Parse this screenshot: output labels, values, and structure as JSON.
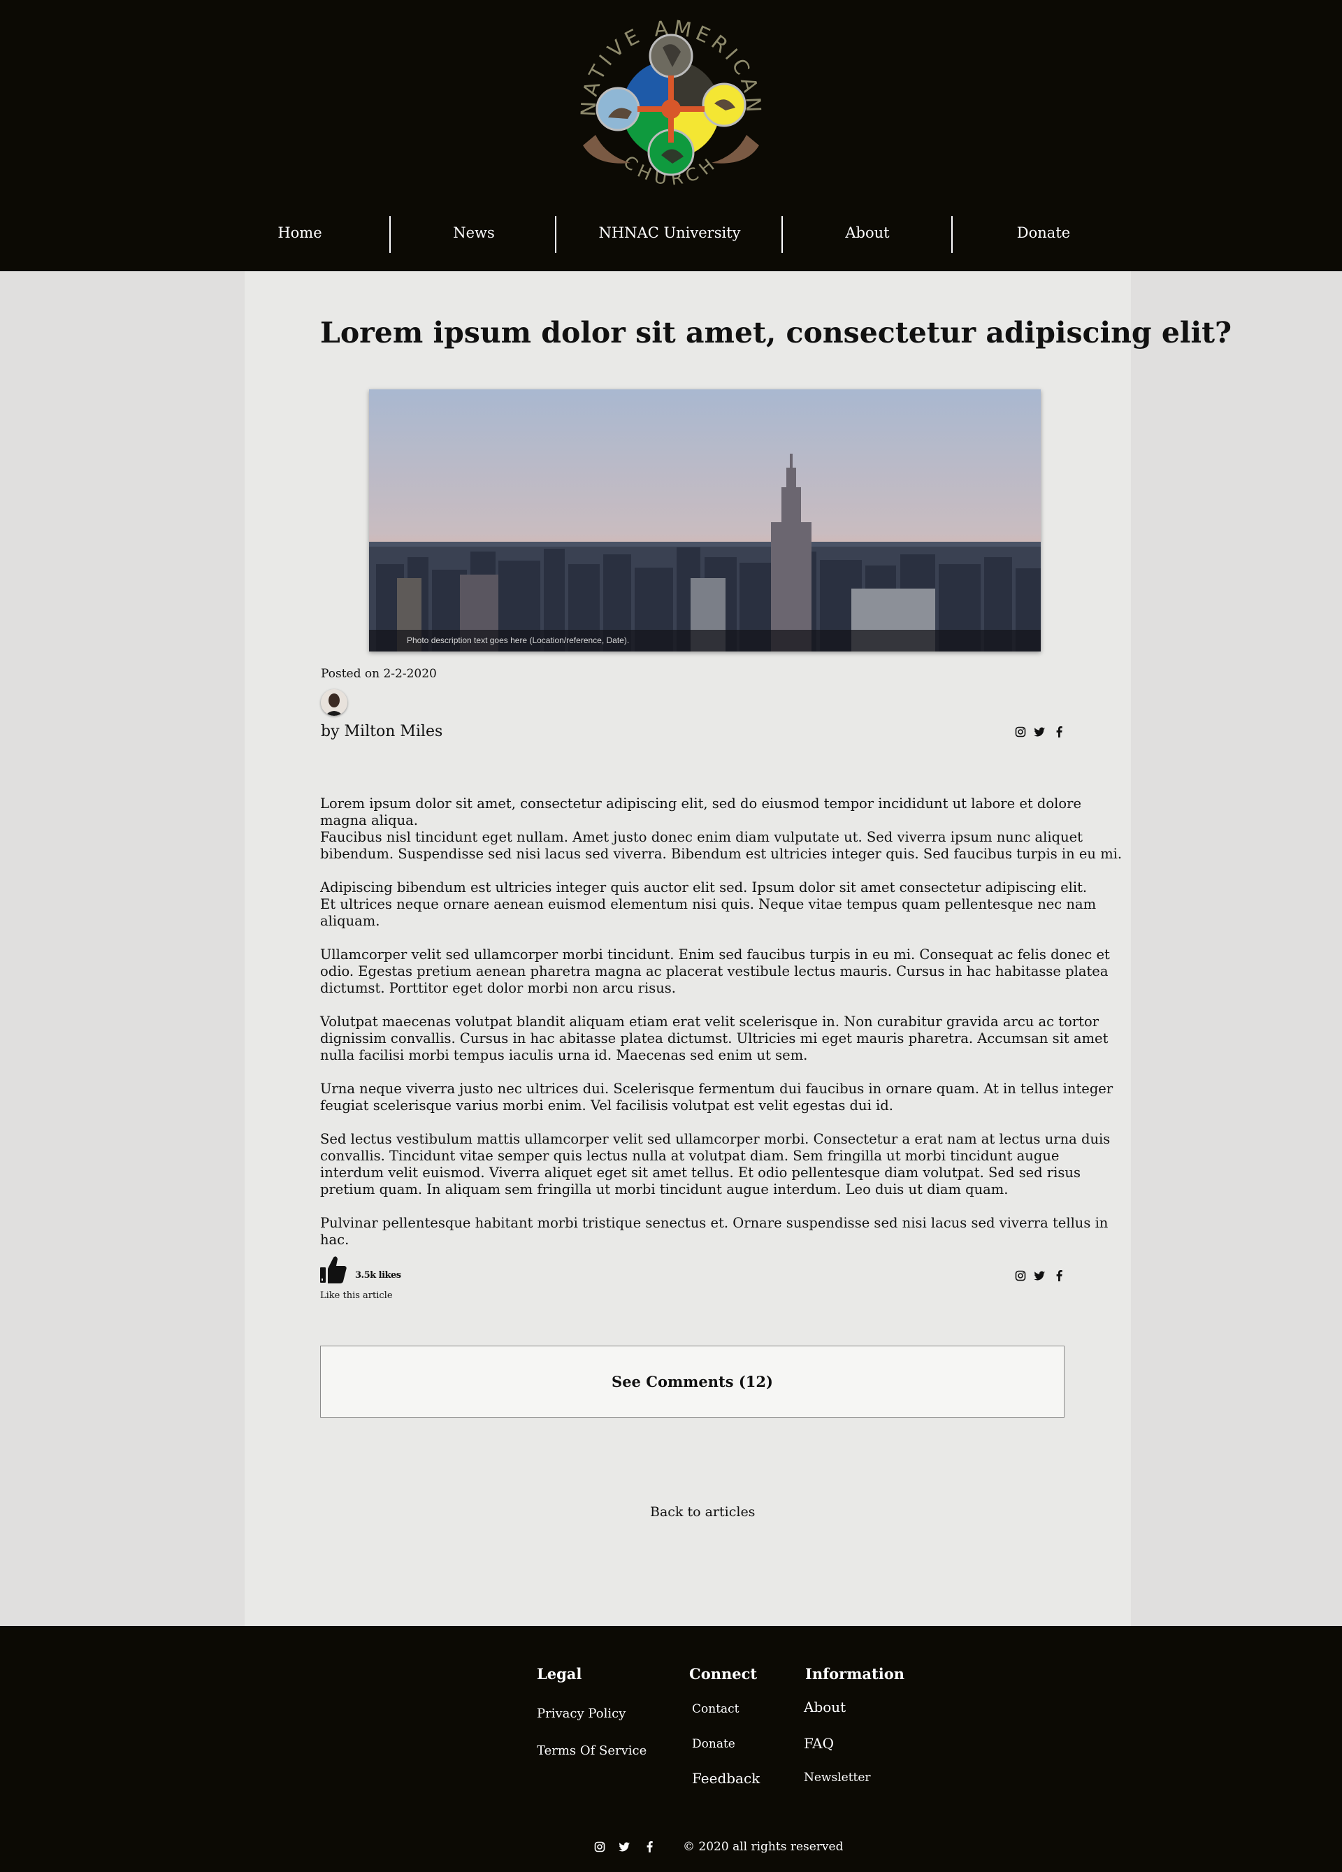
{
  "header": {
    "logo_text_top": "NATIVE AMERICAN",
    "logo_text_bottom": "CHURCH",
    "nav": [
      {
        "label": "Home"
      },
      {
        "label": "News"
      },
      {
        "label": "NHNAC University"
      },
      {
        "label": "About"
      },
      {
        "label": "Donate"
      }
    ]
  },
  "post": {
    "title": "Lorem ipsum dolor sit amet, consectetur adipiscing elit?",
    "photo_caption": "Photo description text goes here (Location/reference, Date).",
    "posted_on": "Posted on 2-2-2020",
    "author": "by Milton Miles",
    "paragraphs": [
      "Lorem ipsum dolor sit amet, consectetur adipiscing elit, sed do eiusmod tempor incididunt ut labore et dolore magna aliqua.\nFaucibus nisl tincidunt eget nullam. Amet justo donec enim diam vulputate ut. Sed viverra ipsum nunc aliquet bibendum. Suspendisse sed nisi lacus sed viverra. Bibendum est ultricies integer quis. Sed faucibus turpis in eu mi.",
      "Adipiscing bibendum est ultricies integer quis auctor elit sed. Ipsum dolor sit amet consectetur adipiscing elit.\nEt ultrices neque ornare aenean euismod elementum nisi quis. Neque vitae tempus quam pellentesque nec nam aliquam.",
      "Ullamcorper velit sed ullamcorper morbi tincidunt. Enim sed faucibus turpis in eu mi. Consequat ac felis donec et odio. Egestas pretium aenean pharetra magna ac placerat vestibule lectus mauris. Cursus in hac habitasse platea dictumst. Porttitor eget dolor morbi non arcu risus.",
      "Volutpat maecenas volutpat blandit aliquam etiam erat velit scelerisque in. Non curabitur gravida arcu ac tortor dignissim convallis. Cursus in hac abitasse platea dictumst. Ultricies mi eget mauris pharetra. Accumsan sit amet nulla facilisi morbi tempus iaculis urna id. Maecenas sed enim ut sem.",
      "Urna neque viverra justo nec ultrices dui. Scelerisque fermentum dui faucibus in ornare quam. At in tellus integer feugiat scelerisque varius morbi enim. Vel facilisis volutpat est velit egestas dui id.",
      "Sed lectus vestibulum mattis ullamcorper velit sed ullamcorper morbi. Consectetur a erat nam at lectus urna duis convallis. Tincidunt vitae semper quis lectus nulla at volutpat diam. Sem fringilla ut morbi tincidunt augue interdum velit euismod. Viverra aliquet eget sit amet tellus. Et odio pellentesque diam volutpat. Sed sed risus pretium quam. In aliquam sem fringilla ut morbi tincidunt augue interdum. Leo duis ut diam quam.",
      "Pulvinar pellentesque habitant morbi tristique senectus et. Ornare suspendisse sed nisi lacus sed viverra tellus in hac."
    ],
    "likes_count": "3.5k likes",
    "like_label": "Like this article",
    "comments_button": "See Comments (12)",
    "back_link": "Back to articles"
  },
  "social_icons": [
    "instagram-icon",
    "twitter-icon",
    "facebook-icon"
  ],
  "footer": {
    "legal": {
      "heading": "Legal",
      "links": [
        "Privacy Policy",
        "Terms Of Service"
      ]
    },
    "connect": {
      "heading": "Connect",
      "links": [
        "Contact",
        "Donate",
        "Feedback"
      ]
    },
    "information": {
      "heading": "Information",
      "links": [
        "About",
        "FAQ",
        "Newsletter"
      ]
    },
    "copyright": "© 2020 all rights reserved"
  },
  "colors": {
    "header_bg": "#0c0a04",
    "content_bg": "#e9e9e7",
    "page_bg": "#e0dfde",
    "logo_blue": "#1e5aa8",
    "logo_yellow": "#f4e633",
    "logo_green": "#0f9a3e",
    "logo_red": "#d8572a"
  }
}
